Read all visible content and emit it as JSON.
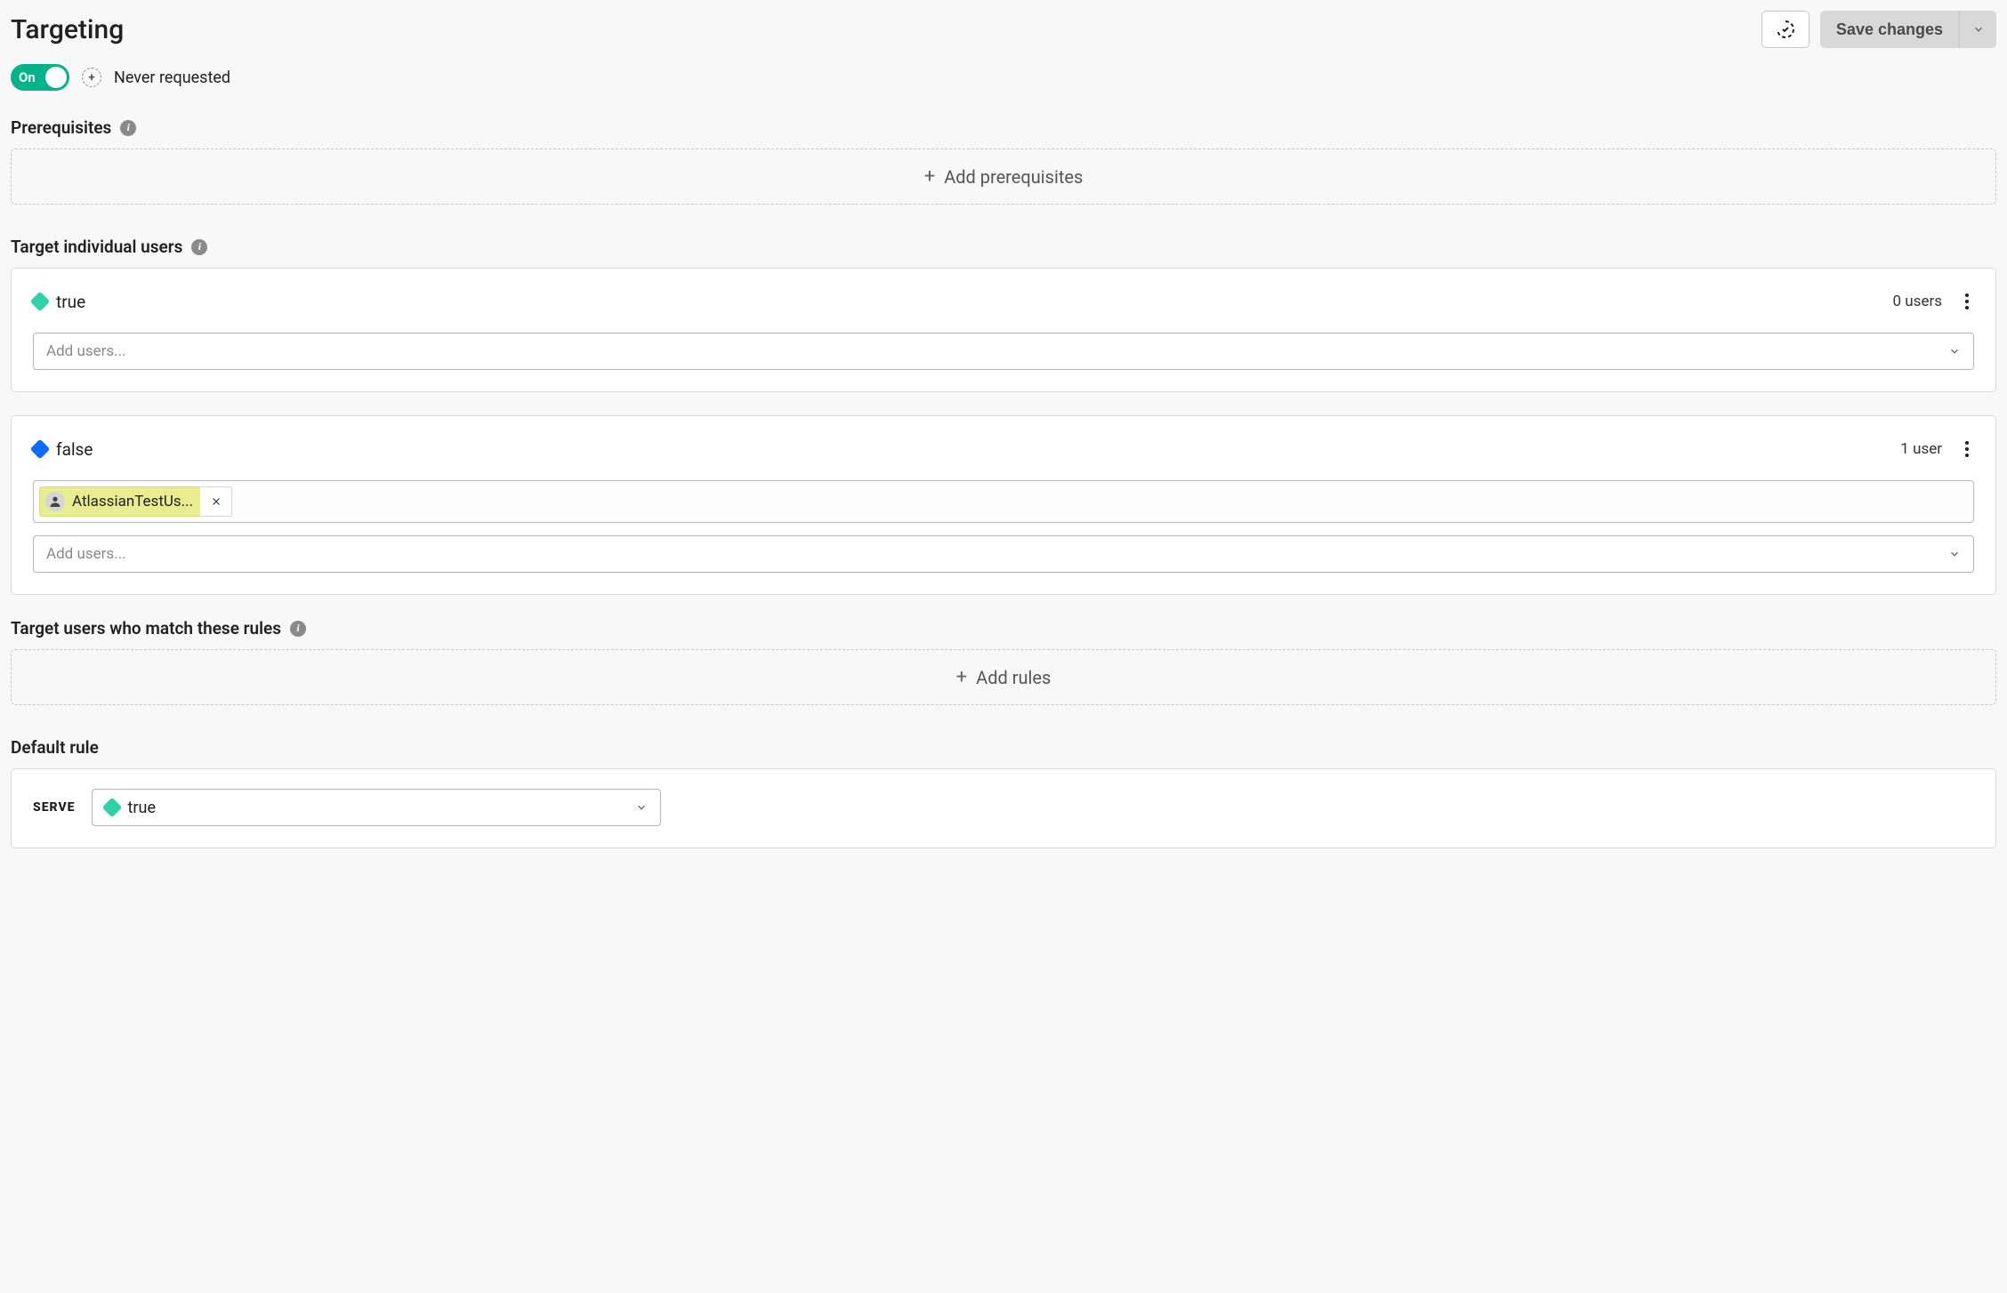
{
  "header": {
    "title": "Targeting",
    "save_label": "Save changes"
  },
  "status": {
    "toggle_label": "On",
    "never_requested": "Never requested"
  },
  "sections": {
    "prerequisites": {
      "title": "Prerequisites",
      "add_label": "Add prerequisites"
    },
    "individual_users": {
      "title": "Target individual users",
      "variations": [
        {
          "name": "true",
          "count_label": "0 users",
          "placeholder": "Add users..."
        },
        {
          "name": "false",
          "count_label": "1 user",
          "placeholder": "Add users...",
          "chips": [
            {
              "label": "AtlassianTestUs..."
            }
          ]
        }
      ]
    },
    "rules": {
      "title": "Target users who match these rules",
      "add_label": "Add rules"
    },
    "default_rule": {
      "title": "Default rule",
      "serve_label": "SERVE",
      "serve_value": "true"
    }
  }
}
